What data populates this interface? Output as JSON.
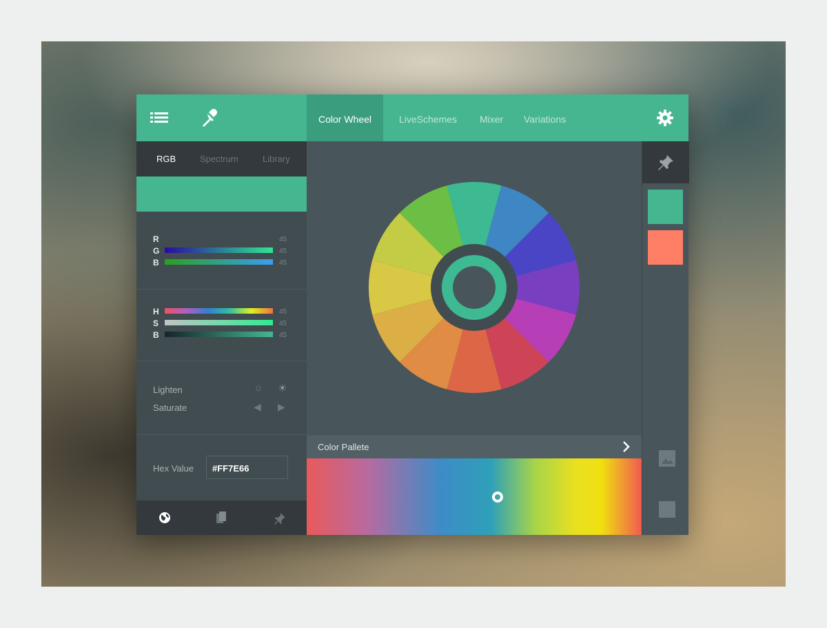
{
  "header": {
    "tabs": [
      {
        "label": "Color Wheel",
        "active": true
      },
      {
        "label": "LiveSchemes"
      },
      {
        "label": "Mixer"
      },
      {
        "label": "Variations"
      }
    ],
    "icons": [
      "list-icon",
      "eyedropper-icon",
      "gear-icon"
    ]
  },
  "left": {
    "subtabs": [
      {
        "label": "RGB",
        "active": true
      },
      {
        "label": "Spectrum"
      },
      {
        "label": "Library"
      }
    ],
    "current_color": "#45b690",
    "rgb": [
      {
        "label": "R",
        "value": "45"
      },
      {
        "label": "G",
        "value": "45"
      },
      {
        "label": "B",
        "value": "45"
      }
    ],
    "hsb": [
      {
        "label": "H",
        "value": "45"
      },
      {
        "label": "S",
        "value": "45"
      },
      {
        "label": "B",
        "value": "45"
      }
    ],
    "adjust": [
      {
        "label": "Lighten"
      },
      {
        "label": "Saturate"
      }
    ],
    "hex": {
      "label": "Hex Value",
      "value": "#FF7E66"
    },
    "bottom_icons": [
      "globe-icon",
      "copy-icon",
      "pin-icon"
    ]
  },
  "wheel": {
    "segments": [
      "#3dba92",
      "#3e86c4",
      "#4a45c4",
      "#7a3fc0",
      "#b63fb8",
      "#cc4455",
      "#dd6646",
      "#e08c45",
      "#dbaf45",
      "#d8c845",
      "#c4cc45",
      "#6cbf45"
    ],
    "selected": "#3dba92"
  },
  "palette": {
    "label": "Color Pallete",
    "slider_position": 0.57
  },
  "swatches": [
    "#45b690",
    "#ff7e66"
  ]
}
